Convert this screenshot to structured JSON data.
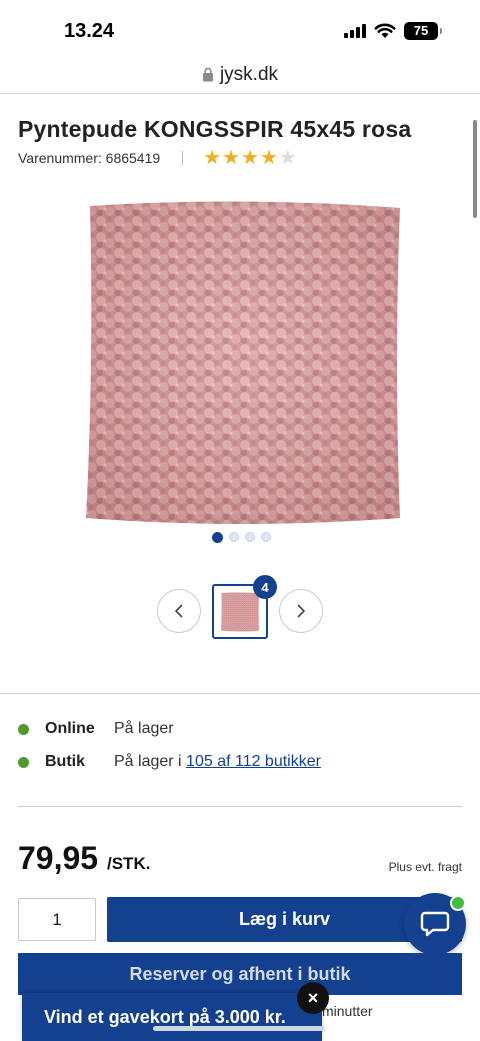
{
  "status_bar": {
    "time": "13.24",
    "battery": "75"
  },
  "browser": {
    "url": "jysk.dk"
  },
  "product": {
    "title": "Pyntepude KONGSSPIR 45x45 rosa",
    "sku_label": "Varenummer: 6865419",
    "rating": {
      "filled": 4,
      "max": 5
    },
    "image_count_badge": "4",
    "gallery": {
      "dots": 4,
      "active_dot": 1
    }
  },
  "availability": {
    "online": {
      "label": "Online",
      "status": "På lager"
    },
    "store": {
      "label": "Butik",
      "status_prefix": "På lager i ",
      "link": "105 af 112 butikker"
    }
  },
  "price": {
    "amount": "79,95",
    "unit": "/STK.",
    "shipping_note": "Plus evt. fragt"
  },
  "cart": {
    "quantity": "1",
    "add_button": "Læg i kurv"
  },
  "reserve": {
    "button": "Reserver og afhent i butik",
    "note_partial": "minutter"
  },
  "promo": {
    "text": "Vind et gavekort på 3.000 kr.",
    "close": "×"
  },
  "colors": {
    "brand_blue": "#13408f",
    "in_stock_green": "#4e9a2e",
    "star_gold": "#f2b01e",
    "pillow_pink": "#d69a9b"
  },
  "icons": [
    "signal-icon",
    "wifi-icon",
    "battery-icon",
    "lock-icon",
    "star-icon",
    "chevron-left-icon",
    "chevron-right-icon",
    "chat-icon",
    "close-icon"
  ]
}
